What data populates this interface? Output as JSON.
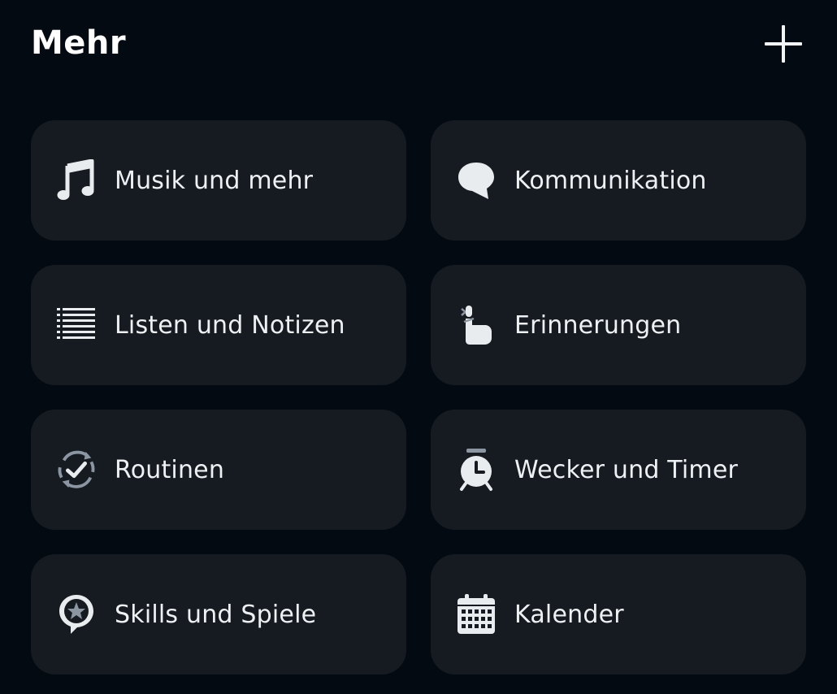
{
  "header": {
    "title": "Mehr",
    "add_icon": "plus-icon"
  },
  "tiles": [
    {
      "label": "Musik und mehr",
      "icon": "music-note-icon"
    },
    {
      "label": "Kommunikation",
      "icon": "speech-bubble-icon"
    },
    {
      "label": "Listen und Notizen",
      "icon": "list-icon"
    },
    {
      "label": "Erinnerungen",
      "icon": "finger-string-icon"
    },
    {
      "label": "Routinen",
      "icon": "routine-check-icon"
    },
    {
      "label": "Wecker und Timer",
      "icon": "alarm-clock-icon"
    },
    {
      "label": "Skills und Spiele",
      "icon": "skills-star-icon"
    },
    {
      "label": "Kalender",
      "icon": "calendar-icon"
    }
  ],
  "colors": {
    "background": "#040a12",
    "tile": "#161b22",
    "text": "#eef1f3",
    "icon": "#e9ecee"
  }
}
